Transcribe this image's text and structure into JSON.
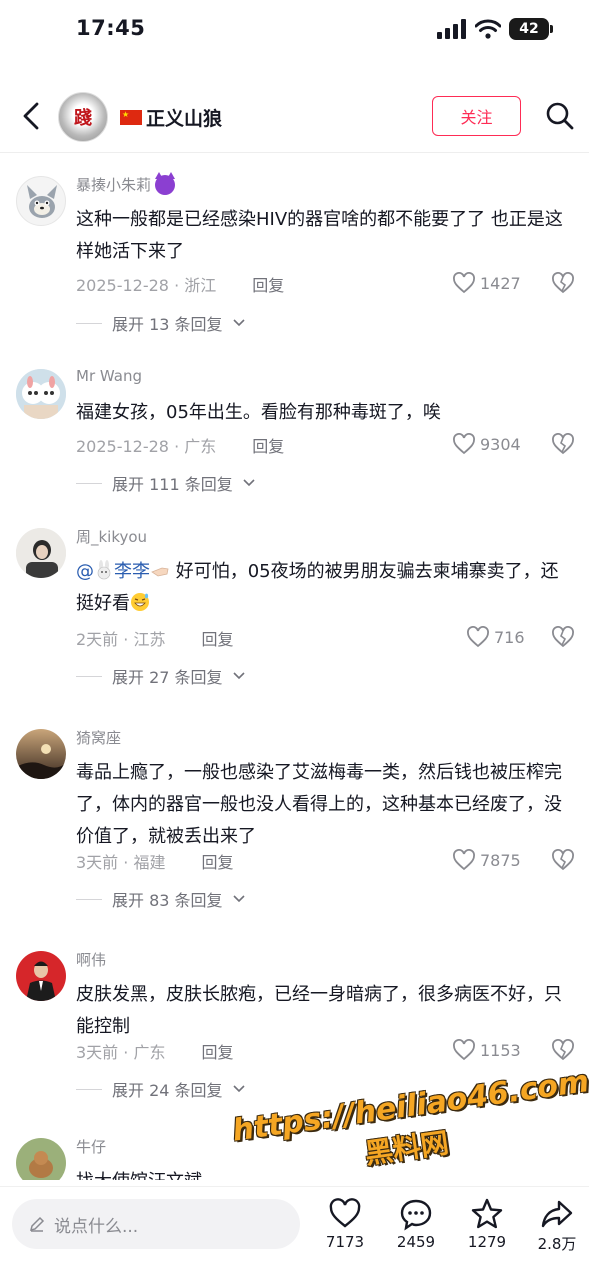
{
  "status_bar": {
    "time": "17:45",
    "battery": "42"
  },
  "header": {
    "avatar_text": "踐",
    "title": "正义山狼",
    "follow_label": "关注"
  },
  "comments": [
    {
      "user": "暴揍小朱莉",
      "text": "这种一般都是已经感染HIV的器官啥的都不能要了了 也正是这样她活下来了",
      "time": "2025-12-28 · 浙江",
      "reply": "回复",
      "likes": "1427",
      "expand": "展开 13 条回复"
    },
    {
      "user": "Mr Wang",
      "text": "福建女孩，05年出生。看脸有那种毒斑了，唉",
      "time": "2025-12-28 · 广东",
      "reply": "回复",
      "likes": "9304",
      "expand": "展开 111 条回复"
    },
    {
      "user": "周_kikyou",
      "mention": "@",
      "mention_name": "李李",
      "text": " 好可怕，05夜场的被男朋友骗去柬埔寨卖了，还挺好看",
      "time": "2天前 · 江苏",
      "reply": "回复",
      "likes": "716",
      "expand": "展开 27 条回复"
    },
    {
      "user": "猗窝座",
      "text": "毒品上瘾了，一般也感染了艾滋梅毒一类，然后钱也被压榨完了，体内的器官一般也没人看得上的，这种基本已经废了，没价值了，就被丢出来了",
      "time": "3天前 · 福建",
      "reply": "回复",
      "likes": "7875",
      "expand": "展开 83 条回复"
    },
    {
      "user": "啊伟",
      "text": "皮肤发黑，皮肤长脓疱，已经一身暗病了，很多病医不好，只能控制",
      "time": "3天前 · 广东",
      "reply": "回复",
      "likes": "1153",
      "expand": "展开 24 条回复"
    },
    {
      "user": "牛仔",
      "text": "找大使馆汪文斌"
    }
  ],
  "watermark": {
    "url": "https://heiliao46.com",
    "name": "黑料网"
  },
  "bottom": {
    "input_placeholder": "说点什么...",
    "like_count": "7173",
    "comment_count": "2459",
    "favorite_count": "1279",
    "share_count": "2.8万"
  },
  "colors": {
    "accent": "#fe2c55",
    "mention": "#2a5db0",
    "muted": "#a1a2a7"
  }
}
